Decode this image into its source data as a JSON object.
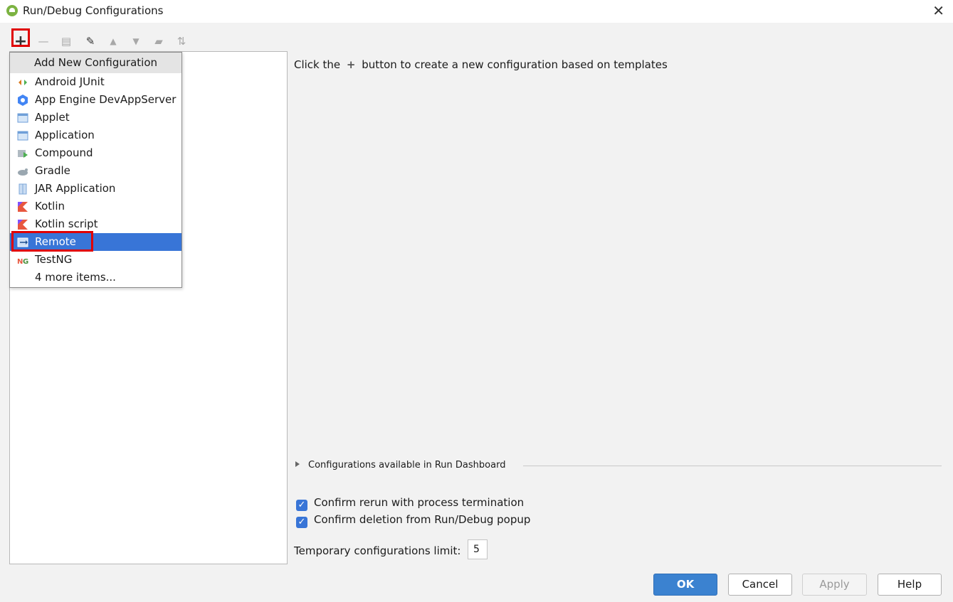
{
  "window": {
    "title": "Run/Debug Configurations",
    "close_glyph": "✕"
  },
  "toolbar": {
    "buttons": [
      {
        "name": "add",
        "glyph": "+"
      },
      {
        "name": "remove",
        "glyph": "—"
      },
      {
        "name": "copy",
        "glyph": "▤"
      },
      {
        "name": "edit-defaults",
        "glyph": "✎"
      },
      {
        "name": "move-up",
        "glyph": "▲"
      },
      {
        "name": "move-down",
        "glyph": "▼"
      },
      {
        "name": "new-folder",
        "glyph": "▰"
      },
      {
        "name": "sort",
        "glyph": "⇅"
      }
    ]
  },
  "popup": {
    "header": "Add New Configuration",
    "items": [
      {
        "label": "Android JUnit",
        "icon": "android-junit-icon",
        "color": "#d97a1e"
      },
      {
        "label": "App Engine DevAppServer",
        "icon": "app-engine-icon",
        "color": "#4285f4"
      },
      {
        "label": "Applet",
        "icon": "applet-icon",
        "color": "#6f9fd8"
      },
      {
        "label": "Application",
        "icon": "application-icon",
        "color": "#6f9fd8"
      },
      {
        "label": "Compound",
        "icon": "compound-icon",
        "color": "#9aa7b0"
      },
      {
        "label": "Gradle",
        "icon": "gradle-icon",
        "color": "#9aa7b0"
      },
      {
        "label": "JAR Application",
        "icon": "jar-icon",
        "color": "#7ea7d8"
      },
      {
        "label": "Kotlin",
        "icon": "kotlin-icon",
        "color": "#e8573f"
      },
      {
        "label": "Kotlin script",
        "icon": "kotlin-script-icon",
        "color": "#e8573f"
      },
      {
        "label": "Remote",
        "icon": "remote-icon",
        "color": "#5b8ed6",
        "selected": true
      },
      {
        "label": "TestNG",
        "icon": "testng-icon",
        "color": "#e8573f"
      },
      {
        "label": "4 more items...",
        "icon": "",
        "color": ""
      }
    ]
  },
  "main": {
    "hint_before": "Click the",
    "hint_plus": "+",
    "hint_after": "button to create a new configuration based on templates",
    "dashboard_label": "Configurations available in Run Dashboard",
    "checkboxes": [
      {
        "label": "Confirm rerun with process termination",
        "checked": true
      },
      {
        "label": "Confirm deletion from Run/Debug popup",
        "checked": true
      }
    ],
    "temp_limit_label": "Temporary configurations limit:",
    "temp_limit_value": "5"
  },
  "buttons": {
    "ok": "OK",
    "cancel": "Cancel",
    "apply": "Apply",
    "help": "Help"
  },
  "colors": {
    "accent": "#3875d7",
    "highlight_box": "#e00000"
  }
}
